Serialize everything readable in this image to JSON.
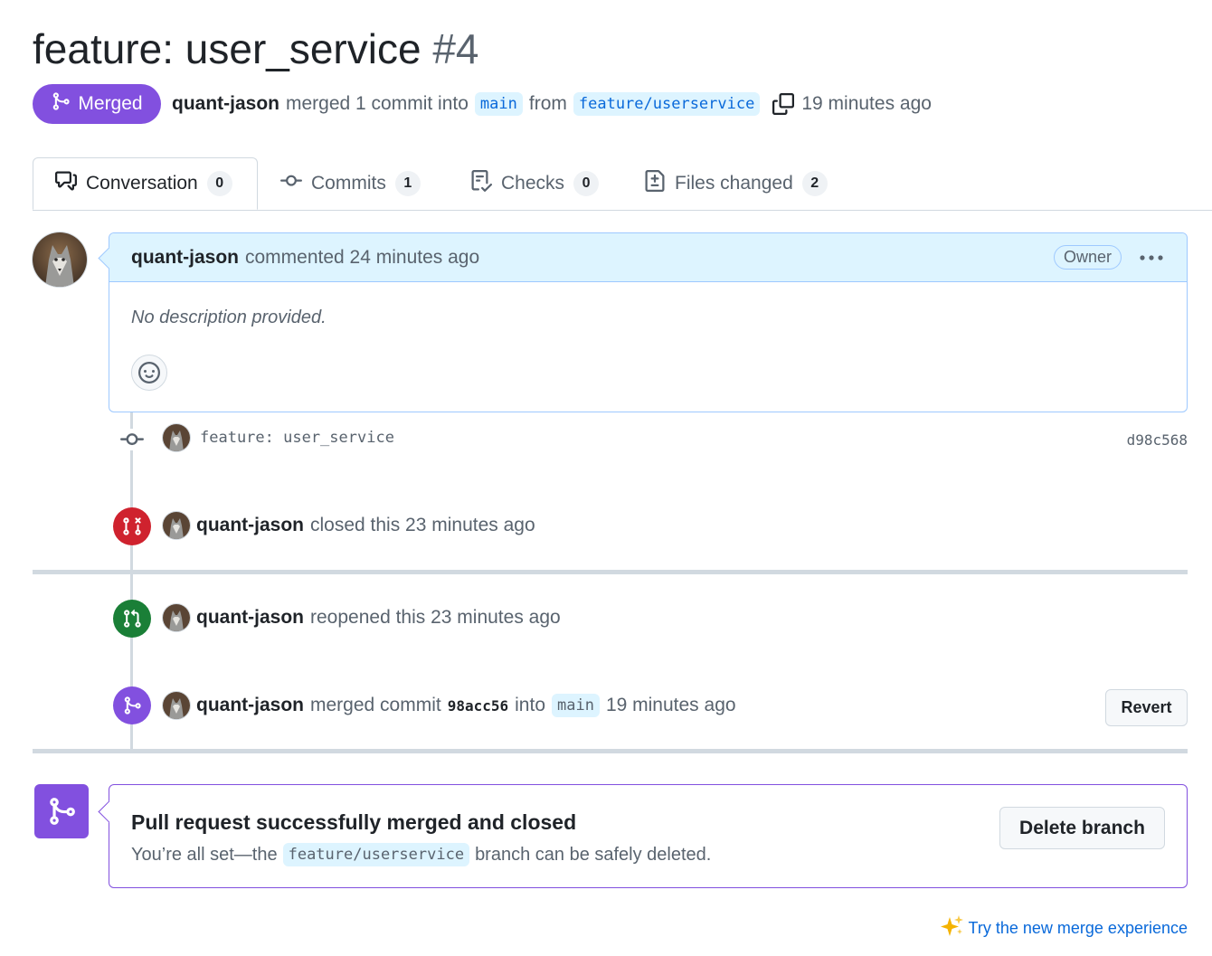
{
  "pr": {
    "title": "feature: user_service",
    "number": "#4",
    "state": "Merged",
    "author": "quant-jason",
    "merge_text": "merged 1 commit into",
    "base_branch": "main",
    "from_text": "from",
    "head_branch": "feature/userservice",
    "time": "19 minutes ago"
  },
  "tabs": [
    {
      "label": "Conversation",
      "count": "0"
    },
    {
      "label": "Commits",
      "count": "1"
    },
    {
      "label": "Checks",
      "count": "0"
    },
    {
      "label": "Files changed",
      "count": "2"
    }
  ],
  "comment": {
    "author": "quant-jason",
    "action": "commented 24 minutes ago",
    "role": "Owner",
    "body": "No description provided."
  },
  "timeline": {
    "commit": {
      "message": "feature: user_service",
      "sha": "d98c568"
    },
    "closed": {
      "user": "quant-jason",
      "text": "closed this 23 minutes ago"
    },
    "reopened": {
      "user": "quant-jason",
      "text": "reopened this 23 minutes ago"
    },
    "merged": {
      "user": "quant-jason",
      "text": "merged commit",
      "sha": "98acc56",
      "into": "into",
      "branch": "main",
      "time": "19 minutes ago",
      "revert_label": "Revert"
    }
  },
  "merged_box": {
    "title": "Pull request successfully merged and closed",
    "sub_before": "You’re all set—the",
    "branch": "feature/userservice",
    "sub_after": "branch can be safely deleted.",
    "delete_label": "Delete branch"
  },
  "footer": {
    "try_link": "Try the new merge experience"
  },
  "colors": {
    "merged": "#8250df",
    "closed": "#cf222e",
    "open": "#1a7f37",
    "link": "#0969da"
  },
  "icons": [
    "git-merge-icon",
    "copy-icon",
    "comment-discussion-icon",
    "git-commit-icon",
    "checklist-icon",
    "file-diff-icon",
    "kebab-horizontal-icon",
    "smiley-icon",
    "git-pull-request-closed-icon",
    "git-pull-request-icon",
    "sparkles-icon"
  ]
}
